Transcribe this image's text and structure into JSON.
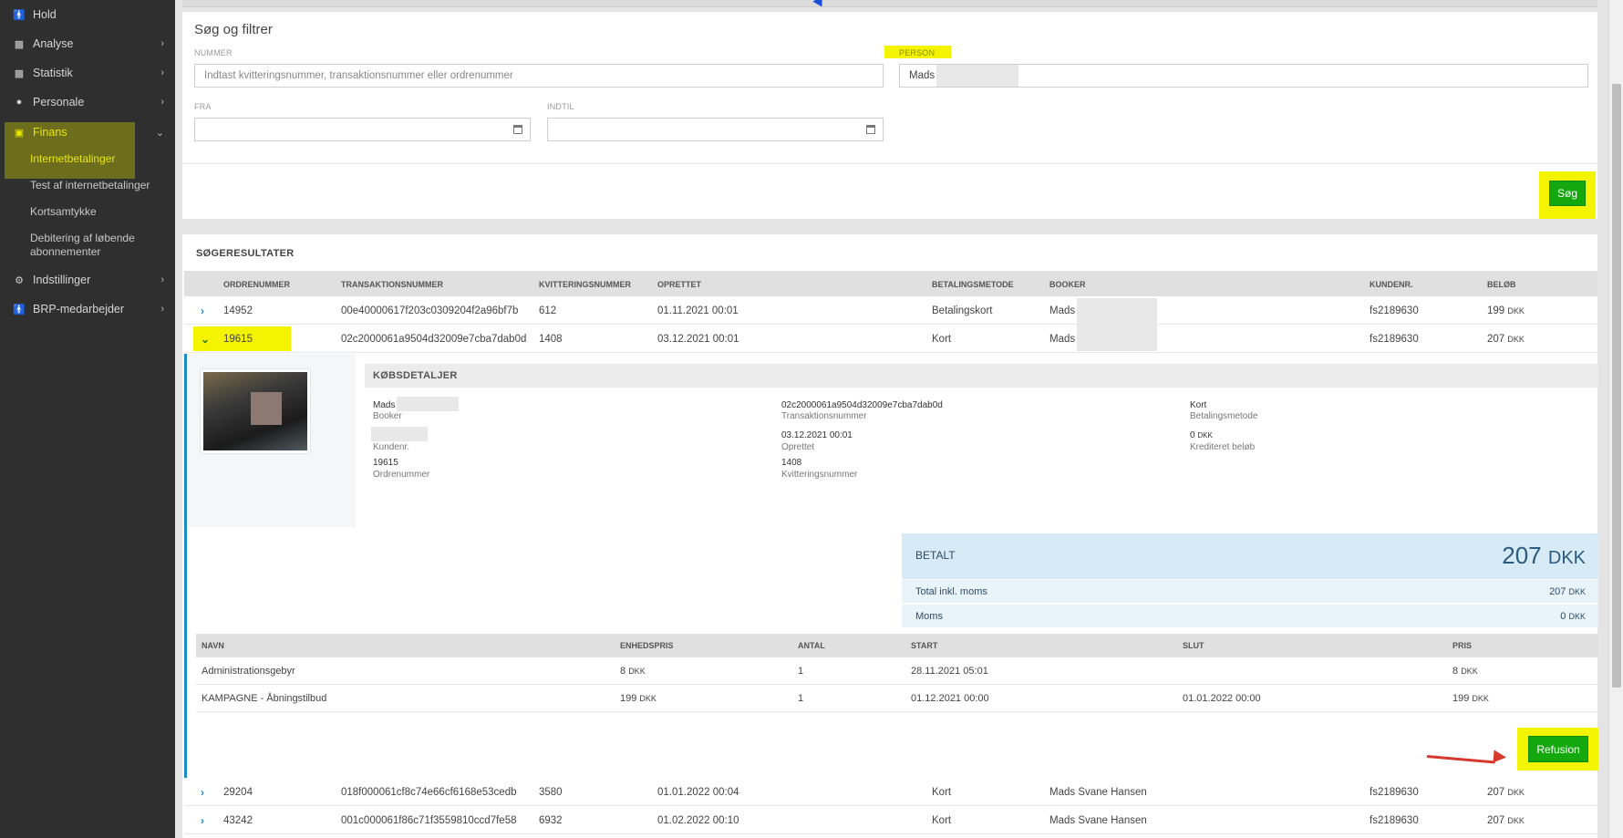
{
  "sidebar": {
    "items": [
      {
        "label": "Hold",
        "icon": "person-icon"
      },
      {
        "label": "Analyse",
        "icon": "bar-chart-icon"
      },
      {
        "label": "Statistik",
        "icon": "bar-chart-icon"
      },
      {
        "label": "Personale",
        "icon": "person-icon"
      },
      {
        "label": "Finans",
        "icon": "money-icon"
      },
      {
        "label": "Indstillinger",
        "icon": "gear-icon"
      },
      {
        "label": "BRP-medarbejder",
        "icon": "person-icon"
      }
    ],
    "finans_sub": [
      "Internetbetalinger",
      "Test af internetbetalinger",
      "Kortsamtykke",
      "Debitering af løbende abonnementer"
    ]
  },
  "filter": {
    "title": "Søg og filtrer",
    "nummer_label": "NUMMER",
    "nummer_placeholder": "Indtast kvitteringsnummer, transaktionsnummer eller ordrenummer",
    "person_label": "PERSON",
    "person_value": "Mads",
    "fra_label": "FRA",
    "indtil_label": "INDTIL",
    "search_button": "Søg"
  },
  "results": {
    "title": "SØGERESULTATER",
    "columns": [
      "ORDRENUMMER",
      "TRANSAKTIONSNUMMER",
      "KVITTERINGSNUMMER",
      "OPRETTET",
      "BETALINGSMETODE",
      "BOOKER",
      "KUNDENR.",
      "BELØB"
    ],
    "rows": [
      {
        "order": "14952",
        "transaction": "00e40000617f203c0309204f2a96bf7b",
        "receipt": "612",
        "created": "01.11.2021 00:01",
        "method": "Betalingskort",
        "booker": "Mads",
        "customer": "fs2189630",
        "amount": "199",
        "currency": "DKK"
      },
      {
        "order": "19615",
        "transaction": "02c2000061a9504d32009e7cba7dab0d",
        "receipt": "1408",
        "created": "03.12.2021 00:01",
        "method": "Kort",
        "booker": "Mads",
        "customer": "fs2189630",
        "amount": "207",
        "currency": "DKK"
      },
      {
        "order": "29204",
        "transaction": "018f000061cf8c74e66cf6168e53cedb",
        "receipt": "3580",
        "created": "01.01.2022 00:04",
        "method": "Kort",
        "booker": "Mads Svane Hansen",
        "customer": "fs2189630",
        "amount": "207",
        "currency": "DKK"
      },
      {
        "order": "43242",
        "transaction": "001c000061f86c71f3559810ccd7fe58",
        "receipt": "6932",
        "created": "01.02.2022 00:10",
        "method": "Kort",
        "booker": "Mads Svane Hansen",
        "customer": "fs2189630",
        "amount": "207",
        "currency": "DKK"
      }
    ]
  },
  "details": {
    "title": "KØBSDETALJER",
    "booker_value": "Mads",
    "booker_key": "Booker",
    "kundenr_key": "Kundenr.",
    "ordrenummer_value": "19615",
    "ordrenummer_key": "Ordrenummer",
    "transaction_value": "02c2000061a9504d32009e7cba7dab0d",
    "transaction_key": "Transaktionsnummer",
    "created_value": "03.12.2021 00:01",
    "created_key": "Oprettet",
    "receipt_value": "1408",
    "receipt_key": "Kvitteringsnummer",
    "method_value": "Kort",
    "method_key": "Betalingsmetode",
    "credited_value": "0",
    "credited_currency": "DKK",
    "credited_key": "Krediteret beløb"
  },
  "summary": {
    "paid_label": "BETALT",
    "paid_amount": "207",
    "paid_currency": "DKK",
    "total_label": "Total inkl. moms",
    "total_amount": "207",
    "moms_label": "Moms",
    "moms_amount": "0",
    "currency": "DKK"
  },
  "lines": {
    "columns": [
      "NAVN",
      "ENHEDSPRIS",
      "ANTAL",
      "START",
      "SLUT",
      "PRIS"
    ],
    "rows": [
      {
        "name": "Administrationsgebyr",
        "unit": "8",
        "qty": "1",
        "start": "28.11.2021 05:01",
        "end": "",
        "price": "8"
      },
      {
        "name": "KAMPAGNE - Åbningstilbud",
        "unit": "199",
        "qty": "1",
        "start": "01.12.2021 00:00",
        "end": "01.01.2022 00:00",
        "price": "199"
      }
    ],
    "currency": "DKK"
  },
  "refund_button": "Refusion",
  "colors": {
    "accent_green": "#14a80e",
    "highlight_yellow": "#f4f400",
    "link_blue": "#1d8ac8"
  }
}
